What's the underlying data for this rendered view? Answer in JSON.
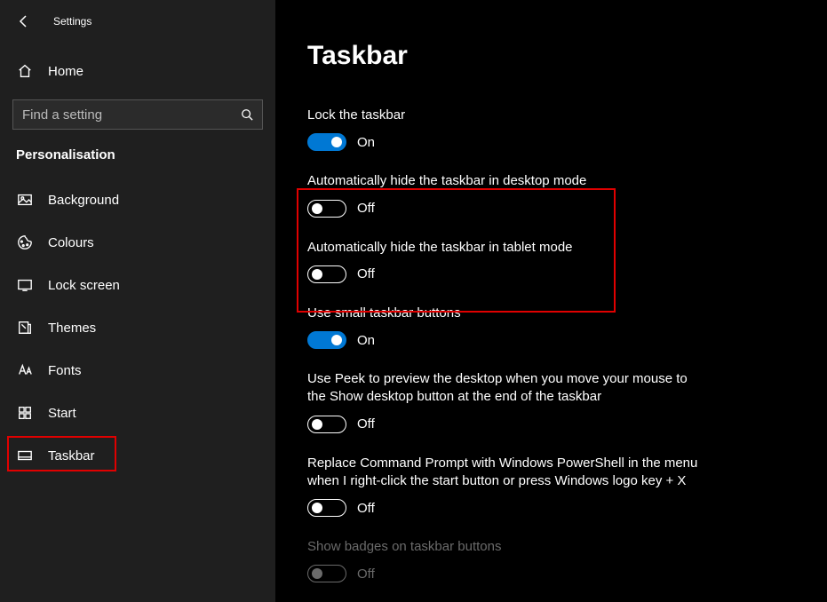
{
  "app_title": "Settings",
  "home_label": "Home",
  "search": {
    "placeholder": "Find a setting"
  },
  "category": "Personalisation",
  "nav": [
    {
      "label": "Background"
    },
    {
      "label": "Colours"
    },
    {
      "label": "Lock screen"
    },
    {
      "label": "Themes"
    },
    {
      "label": "Fonts"
    },
    {
      "label": "Start"
    },
    {
      "label": "Taskbar",
      "selected": true
    }
  ],
  "page_title": "Taskbar",
  "toggle_states": {
    "on": "On",
    "off": "Off"
  },
  "settings": [
    {
      "label": "Lock the taskbar",
      "on": true
    },
    {
      "label": "Automatically hide the taskbar in desktop mode",
      "on": false
    },
    {
      "label": "Automatically hide the taskbar in tablet mode",
      "on": false
    },
    {
      "label": "Use small taskbar buttons",
      "on": true
    },
    {
      "label": "Use Peek to preview the desktop when you move your mouse to the Show desktop button at the end of the taskbar",
      "on": false
    },
    {
      "label": "Replace Command Prompt with Windows PowerShell in the menu when I right-click the start button or press Windows logo key + X",
      "on": false
    },
    {
      "label": "Show badges on taskbar buttons",
      "on": false,
      "disabled": true
    }
  ]
}
